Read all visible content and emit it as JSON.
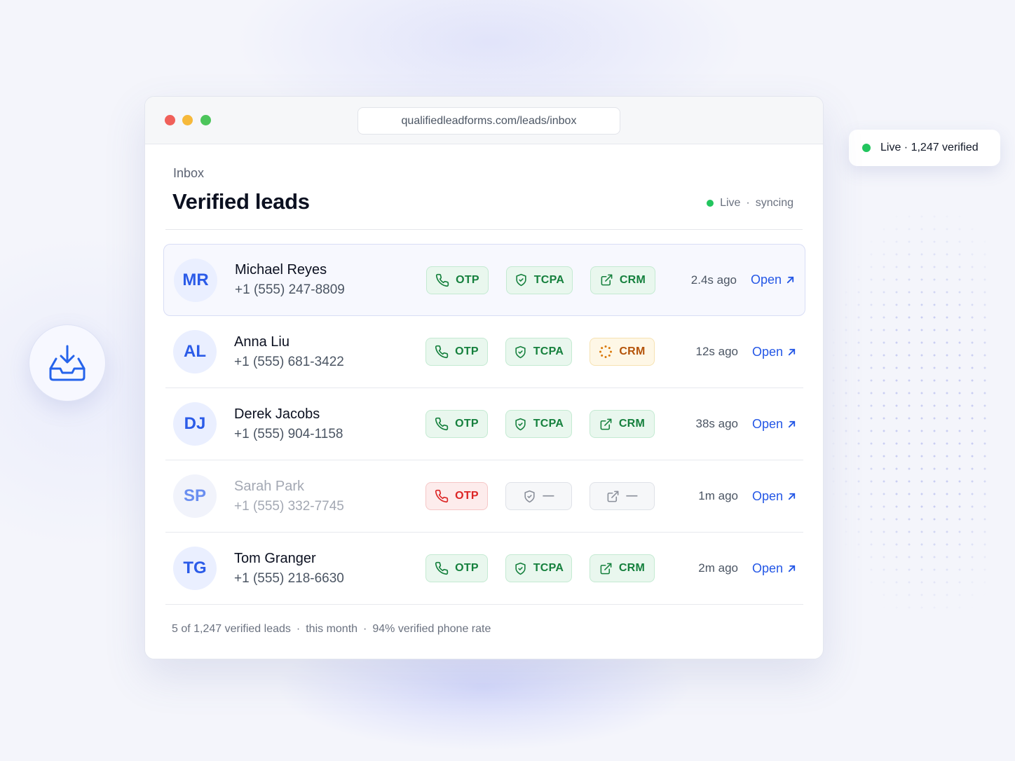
{
  "window": {
    "url": "qualifiedleadforms.com/leads/inbox",
    "breadcrumb": "Inbox",
    "title": "Verified leads",
    "status": {
      "live": "Live",
      "sep": "·",
      "state": "syncing"
    }
  },
  "floating_pill": {
    "text": "Live · 1,247 verified"
  },
  "badge_labels": {
    "otp": "OTP",
    "tcpa": "TCPA",
    "crm": "CRM",
    "dash": "—"
  },
  "leads": [
    {
      "initials": "MR",
      "name": "Michael Reyes",
      "phone": "+1 (555) 247-8809",
      "otp": "OTP",
      "tcpa": "TCPA",
      "crm": "CRM",
      "crm_state": "synced",
      "time": "2.4s ago",
      "action": "Open"
    },
    {
      "initials": "AL",
      "name": "Anna Liu",
      "phone": "+1 (555) 681-3422",
      "otp": "OTP",
      "tcpa": "TCPA",
      "crm": "CRM",
      "crm_state": "pending",
      "time": "12s ago",
      "action": "Open"
    },
    {
      "initials": "DJ",
      "name": "Derek Jacobs",
      "phone": "+1 (555) 904-1158",
      "otp": "OTP",
      "tcpa": "TCPA",
      "crm": "CRM",
      "crm_state": "synced",
      "time": "38s ago",
      "action": "Open"
    },
    {
      "initials": "SP",
      "name": "Sarah Park",
      "phone": "+1 (555) 332-7745",
      "otp": "OTP",
      "tcpa": "—",
      "crm": "—",
      "crm_state": "none",
      "time": "1m ago",
      "action": "Open"
    },
    {
      "initials": "TG",
      "name": "Tom Granger",
      "phone": "+1 (555) 218-6630",
      "otp": "OTP",
      "tcpa": "TCPA",
      "crm": "CRM",
      "crm_state": "synced",
      "time": "2m ago",
      "action": "Open"
    }
  ],
  "footer": {
    "count": "5 of 1,247 verified leads",
    "period": "this month",
    "rate": "94% verified phone rate",
    "sep": "·"
  },
  "colors": {
    "accent": "#2457e6",
    "success": "#15803d",
    "pending": "#b45309",
    "error": "#dc2626",
    "live": "#22c55e"
  },
  "icons": {
    "inbox": "inbox-download-icon",
    "phone": "phone-icon",
    "shield": "shield-check-icon",
    "external": "external-link-icon",
    "spinner": "loading-spinner-icon",
    "arrow": "arrow-up-right-icon"
  }
}
